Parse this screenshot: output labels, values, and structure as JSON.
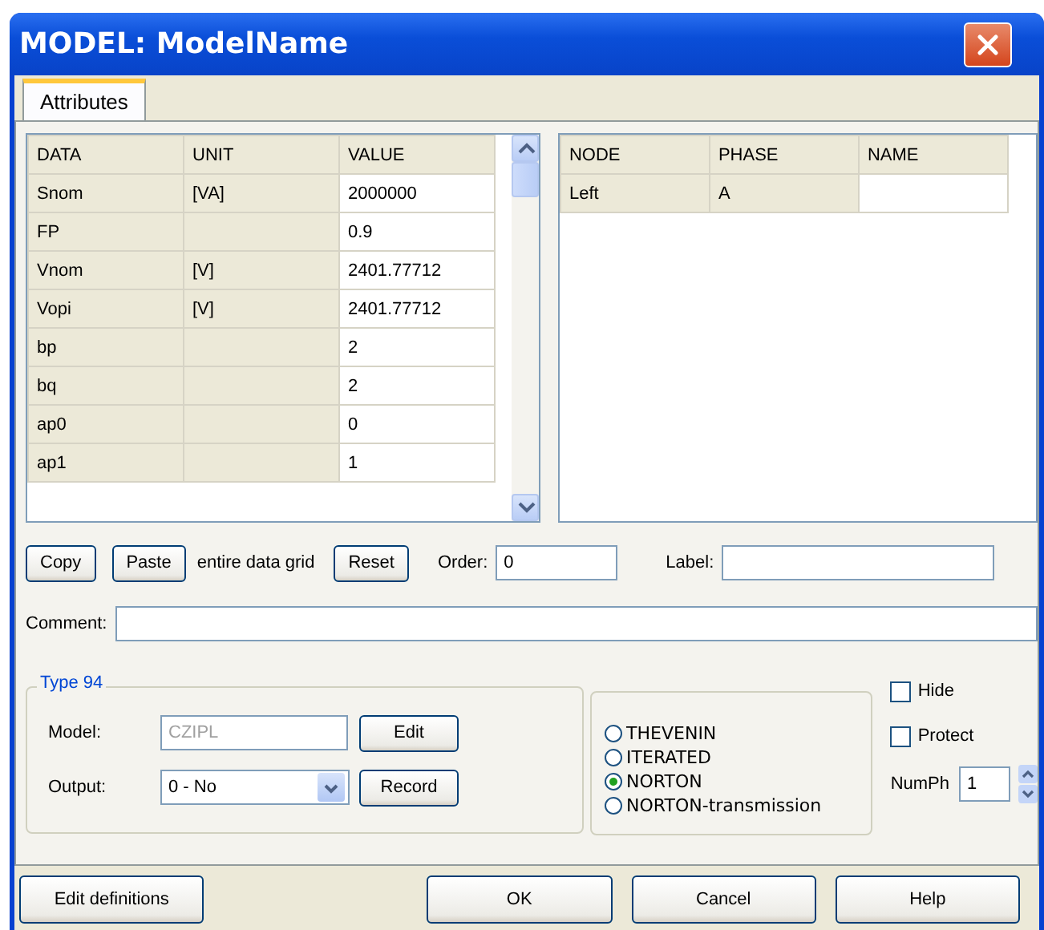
{
  "window": {
    "title": "MODEL: ModelName"
  },
  "tabs": [
    {
      "label": "Attributes",
      "selected": true
    }
  ],
  "data_grid": {
    "columns": [
      {
        "label": "DATA",
        "editable": false
      },
      {
        "label": "UNIT",
        "editable": false
      },
      {
        "label": "VALUE",
        "editable": true
      }
    ],
    "rows": [
      [
        "Snom",
        "[VA]",
        "2000000"
      ],
      [
        "FP",
        "",
        "0.9"
      ],
      [
        "Vnom",
        "[V]",
        "2401.77712"
      ],
      [
        "Vopi",
        "[V]",
        "2401.77712"
      ],
      [
        "bp",
        "",
        "2"
      ],
      [
        "bq",
        "",
        "2"
      ],
      [
        "ap0",
        "",
        "0"
      ],
      [
        "ap1",
        "",
        "1"
      ]
    ]
  },
  "node_grid": {
    "columns": [
      {
        "label": "NODE",
        "editable": false
      },
      {
        "label": "PHASE",
        "editable": false
      },
      {
        "label": "NAME",
        "editable": true
      }
    ],
    "rows": [
      [
        "Left",
        "A",
        ""
      ]
    ]
  },
  "grid_actions": {
    "copy": "Copy",
    "paste": "Paste",
    "paste_note": "entire data grid",
    "reset": "Reset"
  },
  "order": {
    "label": "Order:",
    "value": "0"
  },
  "label_field": {
    "label": "Label:"
  },
  "comment": {
    "label": "Comment:"
  },
  "type_group": {
    "title": "Type 94",
    "model": {
      "label": "Model:",
      "value": "CZIPL",
      "disabled": true,
      "button": "Edit"
    },
    "output": {
      "label": "Output:",
      "value": "0 - No",
      "button": "Record"
    }
  },
  "solution": [
    {
      "label": "THEVENIN",
      "selected": false
    },
    {
      "label": "ITERATED",
      "selected": false
    },
    {
      "label": "NORTON",
      "selected": true
    },
    {
      "label": "NORTON-transmission",
      "selected": false
    }
  ],
  "flags": [
    {
      "label": "Hide",
      "checked": false
    },
    {
      "label": "Protect",
      "checked": false
    }
  ],
  "numph": {
    "label": "NumPh",
    "value": "1"
  },
  "footer": {
    "edit_definitions": "Edit definitions",
    "ok": "OK",
    "cancel": "Cancel",
    "help": "Help"
  }
}
